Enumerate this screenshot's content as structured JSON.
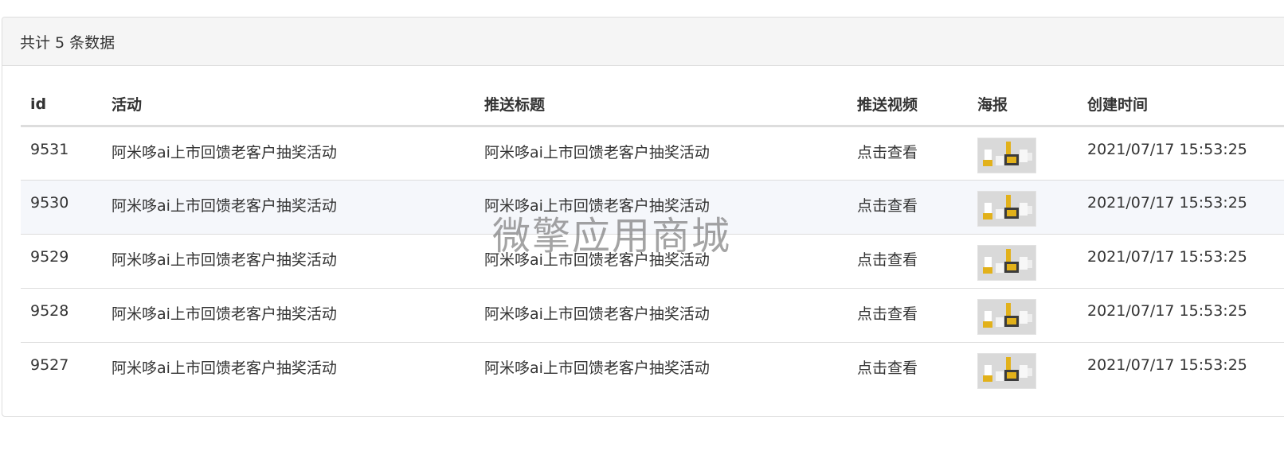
{
  "panel": {
    "heading": "共计 5 条数据"
  },
  "table": {
    "headers": {
      "id": "id",
      "activity": "活动",
      "push_title": "推送标题",
      "push_video": "推送视频",
      "poster": "海报",
      "created_at": "创建时间"
    },
    "rows": [
      {
        "id": "9531",
        "activity": "阿米哆ai上市回馈老客户抽奖活动",
        "push_title": "阿米哆ai上市回馈老客户抽奖活动",
        "push_video": "点击查看",
        "created_at": "2021/07/17 15:53:25"
      },
      {
        "id": "9530",
        "activity": "阿米哆ai上市回馈老客户抽奖活动",
        "push_title": "阿米哆ai上市回馈老客户抽奖活动",
        "push_video": "点击查看",
        "created_at": "2021/07/17 15:53:25"
      },
      {
        "id": "9529",
        "activity": "阿米哆ai上市回馈老客户抽奖活动",
        "push_title": "阿米哆ai上市回馈老客户抽奖活动",
        "push_video": "点击查看",
        "created_at": "2021/07/17 15:53:25"
      },
      {
        "id": "9528",
        "activity": "阿米哆ai上市回馈老客户抽奖活动",
        "push_title": "阿米哆ai上市回馈老客户抽奖活动",
        "push_video": "点击查看",
        "created_at": "2021/07/17 15:53:25"
      },
      {
        "id": "9527",
        "activity": "阿米哆ai上市回馈老客户抽奖活动",
        "push_title": "阿米哆ai上市回馈老客户抽奖活动",
        "push_video": "点击查看",
        "created_at": "2021/07/17 15:53:25"
      }
    ]
  },
  "watermark": "微擎应用商城",
  "colors": {
    "stripe": "#f5f7fb",
    "heading_bg": "#f5f5f5",
    "border": "#dddddd",
    "poster_accent": "#e2b11a"
  }
}
